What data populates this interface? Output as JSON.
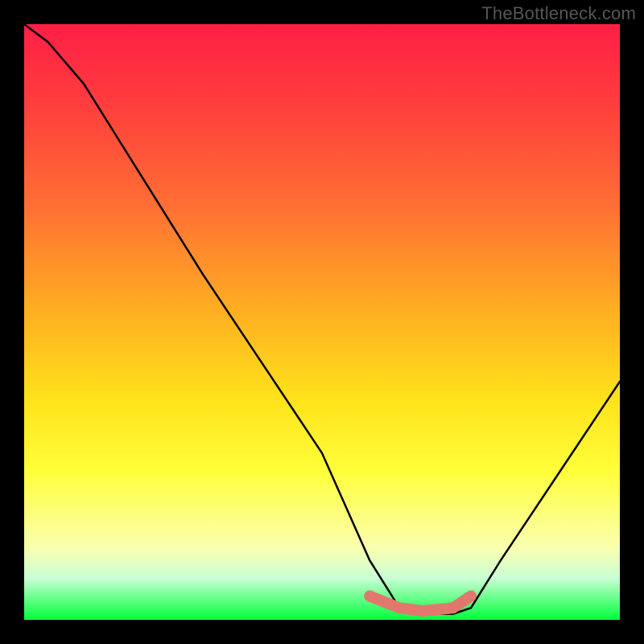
{
  "watermark_text": "TheBottleneck.com",
  "chart_data": {
    "type": "line",
    "title": "",
    "xlabel": "",
    "ylabel": "",
    "xlim": [
      0,
      100
    ],
    "ylim": [
      0,
      100
    ],
    "series": [
      {
        "name": "bottleneck-curve",
        "x": [
          0,
          4,
          10,
          20,
          30,
          40,
          50,
          58,
          63,
          67,
          72,
          75,
          80,
          90,
          100
        ],
        "values": [
          100,
          97,
          90,
          74,
          58,
          43,
          28,
          10,
          2,
          1,
          1,
          2,
          10,
          25,
          40
        ]
      }
    ],
    "highlight": {
      "name": "optimal-range",
      "x": [
        58,
        63,
        67,
        72,
        75
      ],
      "values": [
        4,
        2,
        1.5,
        2,
        4
      ]
    },
    "gradient_stops": [
      {
        "pos": 0,
        "color": "#ff1f46"
      },
      {
        "pos": 12,
        "color": "#ff3a3e"
      },
      {
        "pos": 30,
        "color": "#ff6d34"
      },
      {
        "pos": 48,
        "color": "#ffae22"
      },
      {
        "pos": 63,
        "color": "#ffe21a"
      },
      {
        "pos": 75,
        "color": "#ffff3a"
      },
      {
        "pos": 88,
        "color": "#faffb0"
      },
      {
        "pos": 93,
        "color": "#c9ffd5"
      },
      {
        "pos": 100,
        "color": "#00ff3a"
      }
    ]
  }
}
